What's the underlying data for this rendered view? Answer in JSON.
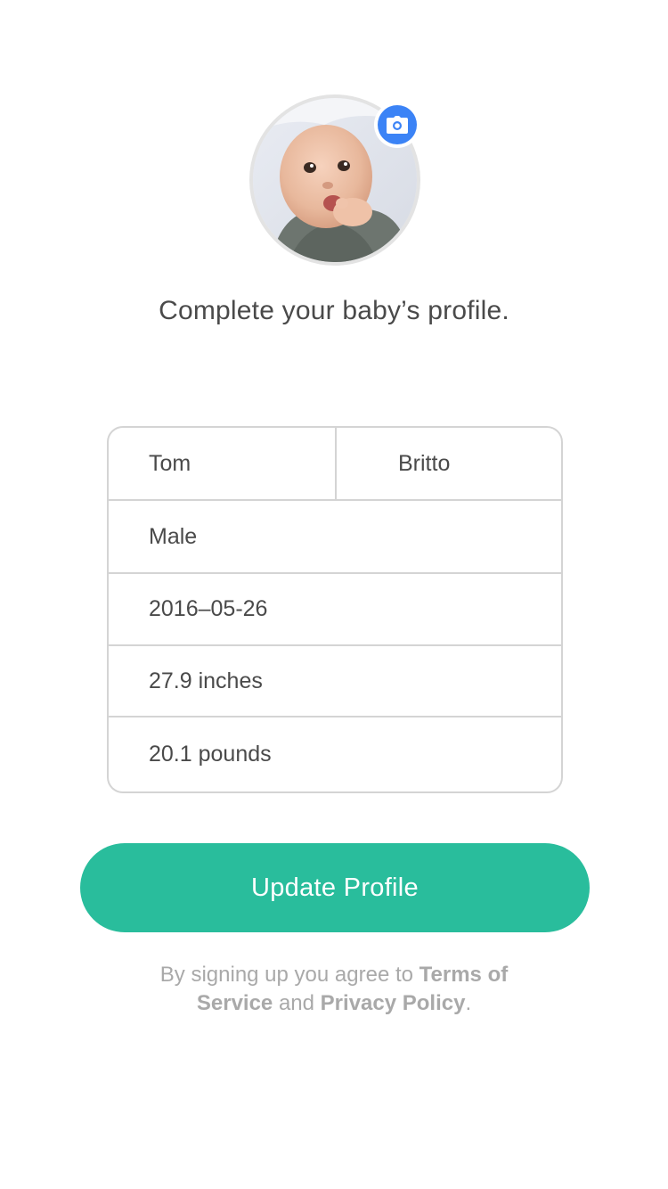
{
  "profile": {
    "heading": "Complete your baby’s profile."
  },
  "icons": {
    "avatar": "baby-photo",
    "camera": "camera-icon"
  },
  "colors": {
    "accent_button": "#29bd9c",
    "camera_badge": "#3b83f6",
    "border": "#d4d4d4",
    "text": "#4a4a4a",
    "muted_text": "#a9a9a9"
  },
  "form": {
    "first_name": "Tom",
    "last_name": "Britto",
    "gender": "Male",
    "birth_date": "2016–05-26",
    "height": "27.9 inches",
    "weight": "20.1 pounds"
  },
  "actions": {
    "update_label": "Update Profile"
  },
  "legal": {
    "prefix": "By signing up you agree to ",
    "terms": "Terms of Service",
    "and": " and ",
    "privacy": "Privacy Policy",
    "suffix": "."
  }
}
